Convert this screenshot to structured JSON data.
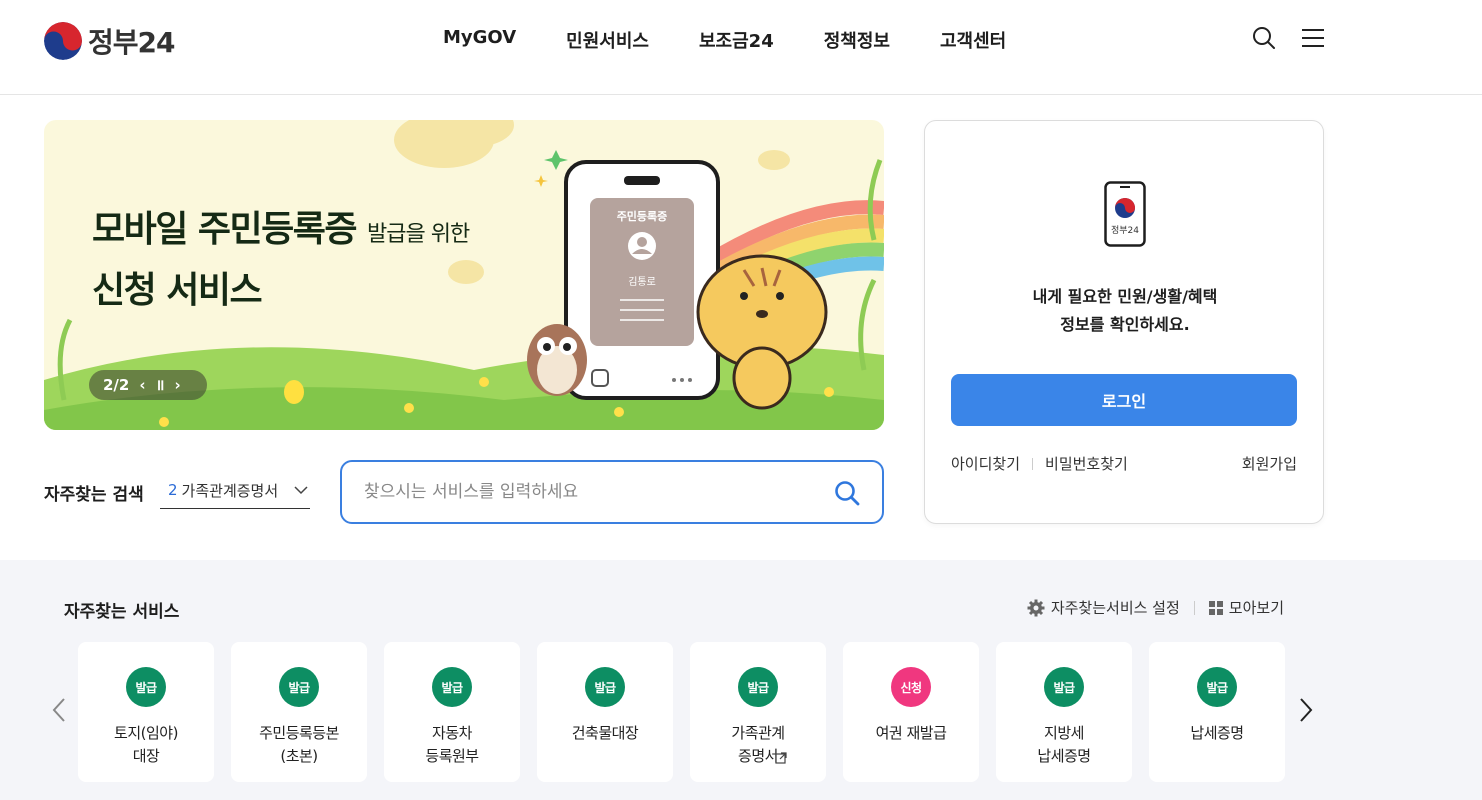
{
  "header": {
    "logo_text": "정부24",
    "nav": [
      "MyGOV",
      "민원서비스",
      "보조금24",
      "정책정보",
      "고객센터"
    ]
  },
  "banner": {
    "title_line1": "모바일 주민등록증",
    "title_line1_small": "발급을 위한",
    "title_line2": "신청 서비스",
    "page_indicator": "2/2",
    "phone_card_title": "주민등록증",
    "phone_card_name": "김통로"
  },
  "search": {
    "label": "자주찾는 검색",
    "select_number": "2",
    "select_value": "가족관계증명서",
    "placeholder": "찾으시는 서비스를 입력하세요"
  },
  "login": {
    "phone_logo_text": "정부24",
    "message_line1": "내게 필요한 민원/생활/혜택",
    "message_line2": "정보를 확인하세요.",
    "button": "로그인",
    "find_id": "아이디찾기",
    "find_pw": "비밀번호찾기",
    "signup": "회원가입"
  },
  "frequent": {
    "title": "자주찾는 서비스",
    "settings": "자주찾는서비스 설정",
    "view_all": "모아보기",
    "items": [
      {
        "badge": "발급",
        "label": "토지(임야)\n대장"
      },
      {
        "badge": "발급",
        "label": "주민등록등본\n(초본)"
      },
      {
        "badge": "발급",
        "label": "자동차\n등록원부"
      },
      {
        "badge": "발급",
        "label": "건축물대장"
      },
      {
        "badge": "발급",
        "label": "가족관계\n증명서"
      },
      {
        "badge": "신청",
        "label": "여권 재발급"
      },
      {
        "badge": "발급",
        "label": "지방세\n납세증명"
      },
      {
        "badge": "발급",
        "label": "납세증명"
      }
    ]
  },
  "colors": {
    "primary": "#3a85e8",
    "badge_green": "#0d8e63",
    "badge_pink": "#f0377f",
    "section_bg": "#f4f5f9"
  }
}
